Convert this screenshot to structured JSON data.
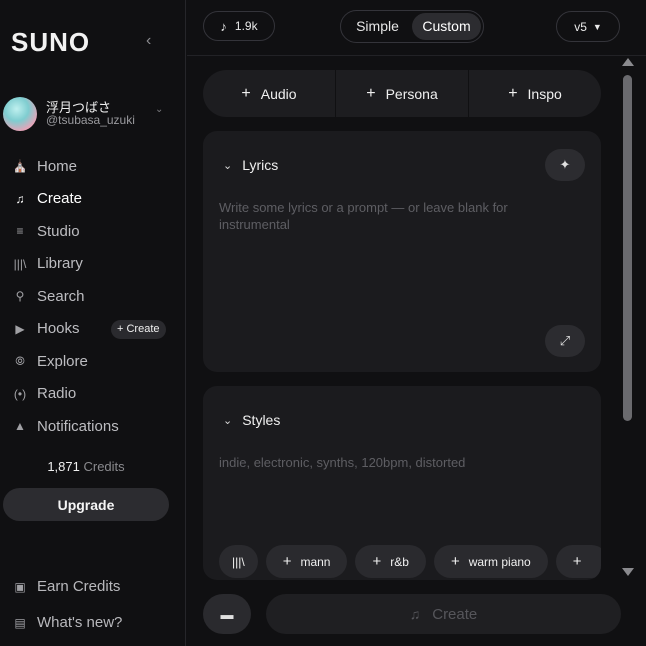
{
  "sidebar": {
    "logo": "SUNO",
    "collapse_icon": "chevron-left",
    "profile": {
      "name": "浮月つばさ",
      "handle": "@tsubasa_uzuki"
    },
    "nav": [
      {
        "label": "Home",
        "icon": "home-icon"
      },
      {
        "label": "Create",
        "icon": "create-icon",
        "active": true
      },
      {
        "label": "Studio",
        "icon": "studio-icon"
      },
      {
        "label": "Library",
        "icon": "library-icon"
      },
      {
        "label": "Search",
        "icon": "search-icon"
      },
      {
        "label": "Hooks",
        "icon": "hooks-icon",
        "badge": "+ Create"
      },
      {
        "label": "Explore",
        "icon": "explore-icon"
      },
      {
        "label": "Radio",
        "icon": "radio-icon"
      },
      {
        "label": "Notifications",
        "icon": "bell-icon"
      }
    ],
    "credits": {
      "amount": "1,871",
      "label": "Credits"
    },
    "upgrade": "Upgrade",
    "earn_credits": "Earn Credits",
    "whats_new": "What's new?"
  },
  "topbar": {
    "song_count": "1.9k",
    "modes": [
      "Simple",
      "Custom"
    ],
    "selected_mode": "Custom",
    "version": "v5"
  },
  "add_buttons": [
    "Audio",
    "Persona",
    "Inspo"
  ],
  "lyrics": {
    "title": "Lyrics",
    "placeholder": "Write some lyrics or a prompt — or leave blank for instrumental"
  },
  "styles": {
    "title": "Styles",
    "placeholder": "indie, electronic, synths, 120bpm, distorted",
    "tags": [
      "mann",
      "r&b",
      "warm piano"
    ]
  },
  "bottom": {
    "create_label": "Create"
  },
  "colors": {
    "background": "#101012",
    "card": "#1b1b1e",
    "button": "#2c2c30"
  }
}
